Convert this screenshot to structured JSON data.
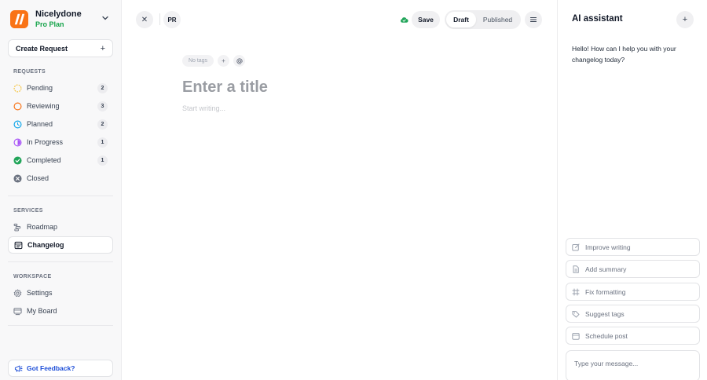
{
  "brand": {
    "name": "Nicelydone",
    "plan": "Pro Plan"
  },
  "create_button": {
    "label": "Create Request"
  },
  "requests": {
    "label": "REQUESTS",
    "items": [
      {
        "label": "Pending",
        "count": "2"
      },
      {
        "label": "Reviewing",
        "count": "3"
      },
      {
        "label": "Planned",
        "count": "2"
      },
      {
        "label": "In Progress",
        "count": "1"
      },
      {
        "label": "Completed",
        "count": "1"
      },
      {
        "label": "Closed"
      }
    ]
  },
  "services": {
    "label": "SERVICES",
    "items": [
      {
        "label": "Roadmap"
      },
      {
        "label": "Changelog"
      }
    ]
  },
  "workspace": {
    "label": "WORKSPACE",
    "items": [
      {
        "label": "Settings"
      },
      {
        "label": "My Board"
      }
    ]
  },
  "feedback": {
    "label": "Got Feedback?"
  },
  "topbar": {
    "pr_label": "PR",
    "save_label": "Save",
    "status_options": [
      "Draft",
      "Published"
    ],
    "status_selected": "Draft"
  },
  "editor": {
    "tags_label": "No tags",
    "title_placeholder": "Enter a title",
    "body_placeholder": "Start writing..."
  },
  "ai": {
    "title": "AI assistant",
    "message": "Hello! How can I help you with your changelog today?",
    "actions": [
      {
        "label": "Improve writing"
      },
      {
        "label": "Add summary"
      },
      {
        "label": "Fix formatting"
      },
      {
        "label": "Suggest tags"
      },
      {
        "label": "Schedule post"
      }
    ],
    "input_placeholder": "Type your message..."
  },
  "colors": {
    "accent_orange": "#f97316",
    "plan_green": "#16a34a",
    "feedback_blue": "#1d4ed8",
    "pending": "#f5c33b",
    "reviewing": "#f97316",
    "planned": "#0ea5e9",
    "in_progress": "#a855f7",
    "completed": "#22a55a",
    "closed": "#6b7280"
  }
}
